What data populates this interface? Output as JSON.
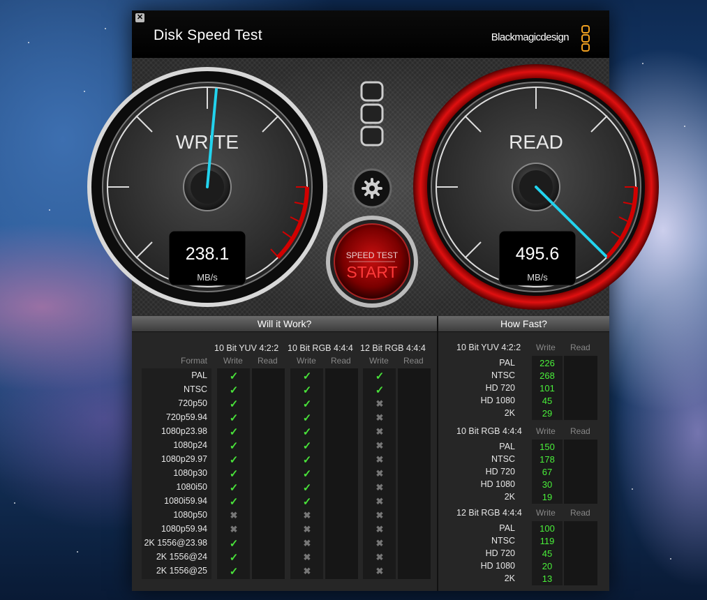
{
  "window": {
    "title": "Disk Speed Test",
    "brand": "Blackmagicdesign",
    "close_glyph": "✕"
  },
  "gauges": {
    "write": {
      "label": "WRITE",
      "value": "238.1",
      "unit": "MB/s"
    },
    "read": {
      "label": "READ",
      "value": "495.6",
      "unit": "MB/s"
    }
  },
  "start_button": {
    "top": "SPEED TEST",
    "main": "START"
  },
  "will_it_work": {
    "title": "Will it Work?",
    "format_header": "Format",
    "groups": [
      "10 Bit YUV 4:2:2",
      "10 Bit RGB 4:4:4",
      "12 Bit RGB 4:4:4"
    ],
    "col_write": "Write",
    "col_read": "Read",
    "rows": [
      {
        "format": "PAL",
        "results": [
          true,
          true,
          true
        ]
      },
      {
        "format": "NTSC",
        "results": [
          true,
          true,
          true
        ]
      },
      {
        "format": "720p50",
        "results": [
          true,
          true,
          false
        ]
      },
      {
        "format": "720p59.94",
        "results": [
          true,
          true,
          false
        ]
      },
      {
        "format": "1080p23.98",
        "results": [
          true,
          true,
          false
        ]
      },
      {
        "format": "1080p24",
        "results": [
          true,
          true,
          false
        ]
      },
      {
        "format": "1080p29.97",
        "results": [
          true,
          true,
          false
        ]
      },
      {
        "format": "1080p30",
        "results": [
          true,
          true,
          false
        ]
      },
      {
        "format": "1080i50",
        "results": [
          true,
          true,
          false
        ]
      },
      {
        "format": "1080i59.94",
        "results": [
          true,
          true,
          false
        ]
      },
      {
        "format": "1080p50",
        "results": [
          false,
          false,
          false
        ]
      },
      {
        "format": "1080p59.94",
        "results": [
          false,
          false,
          false
        ]
      },
      {
        "format": "2K 1556@23.98",
        "results": [
          true,
          false,
          false
        ]
      },
      {
        "format": "2K 1556@24",
        "results": [
          true,
          false,
          false
        ]
      },
      {
        "format": "2K 1556@25",
        "results": [
          true,
          false,
          false
        ]
      }
    ],
    "check_glyph": "✓",
    "cross_glyph": "✖"
  },
  "how_fast": {
    "title": "How Fast?",
    "col_write": "Write",
    "col_read": "Read",
    "groups": [
      {
        "name": "10 Bit YUV 4:2:2",
        "rows": [
          {
            "format": "PAL",
            "write": "226"
          },
          {
            "format": "NTSC",
            "write": "268"
          },
          {
            "format": "HD 720",
            "write": "101"
          },
          {
            "format": "HD 1080",
            "write": "45"
          },
          {
            "format": "2K",
            "write": "29"
          }
        ]
      },
      {
        "name": "10 Bit RGB 4:4:4",
        "rows": [
          {
            "format": "PAL",
            "write": "150"
          },
          {
            "format": "NTSC",
            "write": "178"
          },
          {
            "format": "HD 720",
            "write": "67"
          },
          {
            "format": "HD 1080",
            "write": "30"
          },
          {
            "format": "2K",
            "write": "19"
          }
        ]
      },
      {
        "name": "12 Bit RGB 4:4:4",
        "rows": [
          {
            "format": "PAL",
            "write": "100"
          },
          {
            "format": "NTSC",
            "write": "119"
          },
          {
            "format": "HD 720",
            "write": "45"
          },
          {
            "format": "HD 1080",
            "write": "20"
          },
          {
            "format": "2K",
            "write": "13"
          }
        ]
      }
    ]
  },
  "colors": {
    "check": "#49e23a",
    "value": "#4af03a",
    "needle": "#22d3ee",
    "redzone": "#d10000"
  },
  "icons": [
    "close-icon",
    "settings-gear-icon",
    "check-icon",
    "cross-icon",
    "blackmagic-logo-icon"
  ]
}
